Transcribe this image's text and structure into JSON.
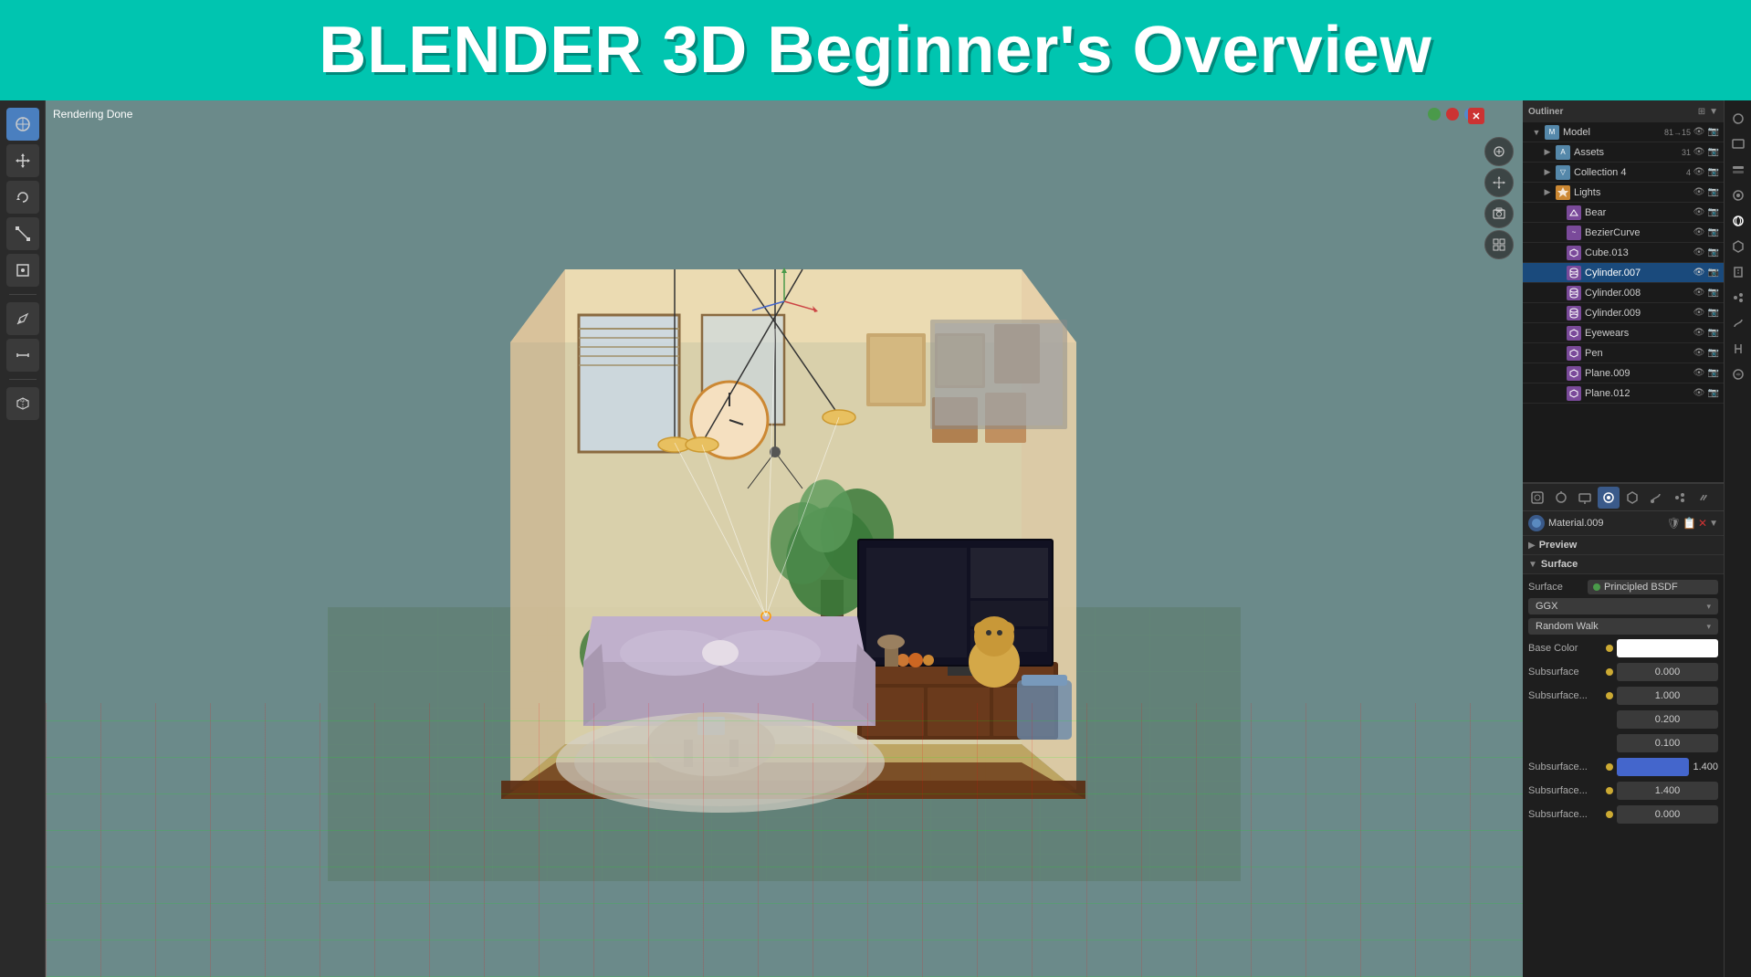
{
  "header": {
    "title": "BLENDER 3D Beginner's Overview"
  },
  "viewport": {
    "status": "Rendering Done"
  },
  "outliner": {
    "items": [
      {
        "id": "model",
        "label": "Model",
        "icon": "mesh",
        "indent": 0,
        "count": "81→15",
        "expanded": true
      },
      {
        "id": "assets",
        "label": "Assets",
        "icon": "collection",
        "indent": 1,
        "count": "31"
      },
      {
        "id": "collection4",
        "label": "Collection 4",
        "icon": "collection",
        "indent": 1,
        "count": "4"
      },
      {
        "id": "lights",
        "label": "Lights",
        "icon": "light",
        "indent": 1
      },
      {
        "id": "bear",
        "label": "Bear",
        "icon": "mesh",
        "indent": 2
      },
      {
        "id": "beziercurve",
        "label": "BezierCurve",
        "icon": "curve",
        "indent": 2
      },
      {
        "id": "cube013",
        "label": "Cube.013",
        "icon": "mesh",
        "indent": 2
      },
      {
        "id": "cylinder007",
        "label": "Cylinder.007",
        "icon": "mesh",
        "indent": 2,
        "selected": true,
        "active": true
      },
      {
        "id": "cylinder008",
        "label": "Cylinder.008",
        "icon": "mesh",
        "indent": 2
      },
      {
        "id": "cylinder009",
        "label": "Cylinder.009",
        "icon": "mesh",
        "indent": 2
      },
      {
        "id": "eyewears",
        "label": "Eyewears",
        "icon": "mesh",
        "indent": 2
      },
      {
        "id": "pen",
        "label": "Pen",
        "icon": "mesh",
        "indent": 2
      },
      {
        "id": "plane009",
        "label": "Plane.009",
        "icon": "mesh",
        "indent": 2
      },
      {
        "id": "plane012",
        "label": "Plane.012",
        "icon": "mesh",
        "indent": 2
      }
    ]
  },
  "properties": {
    "material_name": "Material.009",
    "sections": {
      "preview": {
        "label": "Preview",
        "expanded": false
      },
      "surface": {
        "label": "Surface",
        "expanded": true
      }
    },
    "surface": {
      "shader_type": "Principled BSDF",
      "distribution": "GGX",
      "subsurface_method": "Random Walk",
      "base_color_label": "Base Color",
      "base_color_value": "#ffffff",
      "subsurface_label": "Subsurface",
      "subsurface_value": "0.000",
      "subsurface_radius_label": "Subsurface...",
      "subsurface_radius_value1": "1.000",
      "subsurface_radius_value2": "0.200",
      "subsurface_radius_value3": "0.100",
      "subsurface_color_label": "Subsurface...",
      "subsurface_ior_label": "Subsurface...",
      "subsurface_ior_value": "1.400",
      "subsurface_aniso_label": "Subsurface...",
      "subsurface_aniso_value": "0.000"
    }
  },
  "toolbar": {
    "tools": [
      {
        "id": "viewport-nav",
        "icon": "⊕",
        "tooltip": "Navigate"
      },
      {
        "id": "move",
        "icon": "✛",
        "tooltip": "Move"
      },
      {
        "id": "rotate",
        "icon": "↺",
        "tooltip": "Rotate"
      },
      {
        "id": "scale",
        "icon": "⤢",
        "tooltip": "Scale"
      },
      {
        "id": "transform",
        "icon": "⊞",
        "tooltip": "Transform"
      },
      {
        "id": "annotate",
        "icon": "✏",
        "tooltip": "Annotate"
      },
      {
        "id": "measure",
        "icon": "📏",
        "tooltip": "Measure"
      },
      {
        "id": "add-cube",
        "icon": "⬜",
        "tooltip": "Add Cube"
      }
    ]
  },
  "colors": {
    "header_bg": "#00c5b0",
    "header_text": "#ffffff",
    "viewport_bg": "#6b8a8a",
    "panel_bg": "#1e1e1e",
    "selected_item": "#1a4a7c",
    "accent_green": "#4a9a4a",
    "accent_orange": "#cc8833"
  },
  "color_indicators": {
    "green": "#4a9a4a",
    "red": "#cc3333",
    "blue": "#4466cc"
  }
}
